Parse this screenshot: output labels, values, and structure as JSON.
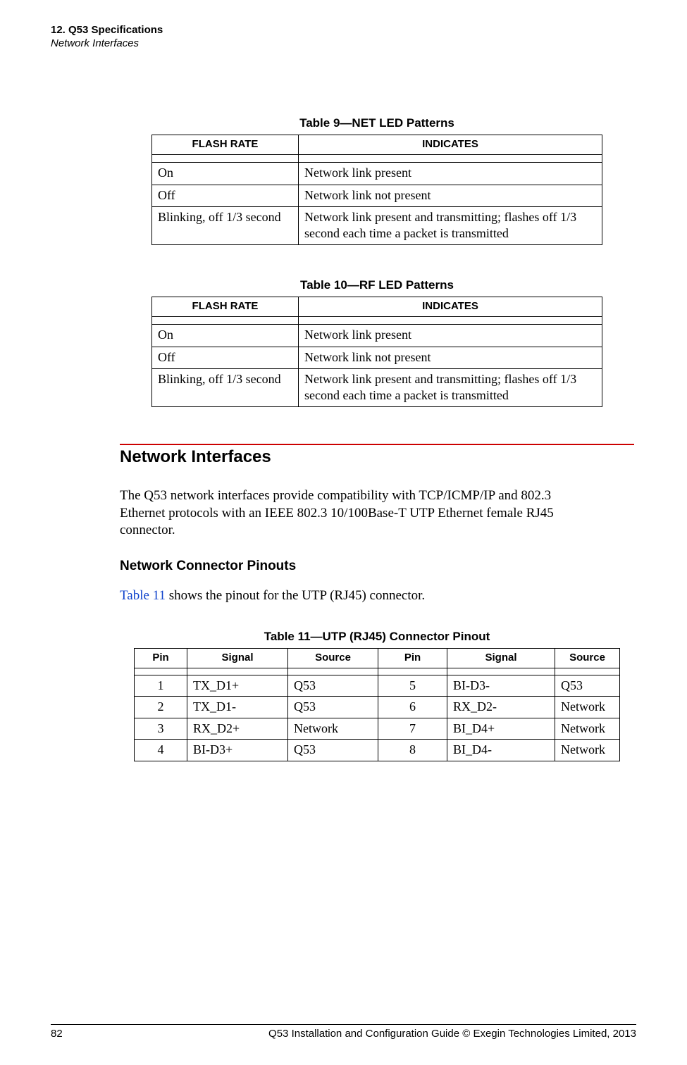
{
  "header": {
    "chapter": "12. Q53 Specifications",
    "section_running": "Network Interfaces"
  },
  "table9": {
    "caption": "Table 9—NET LED Patterns",
    "cols": [
      "FLASH RATE",
      "INDICATES"
    ],
    "rows": [
      {
        "rate": "On",
        "ind": "Network link present"
      },
      {
        "rate": "Off",
        "ind": "Network link not present"
      },
      {
        "rate": "Blinking, off 1/3 second",
        "ind": "Network link present and transmitting; flashes off 1/3 second each time a packet is transmitted"
      }
    ]
  },
  "table10": {
    "caption": "Table 10—RF LED Patterns",
    "cols": [
      "FLASH RATE",
      "INDICATES"
    ],
    "rows": [
      {
        "rate": "On",
        "ind": "Network link present"
      },
      {
        "rate": "Off",
        "ind": "Network link not present"
      },
      {
        "rate": "Blinking, off 1/3 second",
        "ind": "Network link present and transmitting; flashes off 1/3 second each time a packet is transmitted"
      }
    ]
  },
  "section": {
    "title": "Network Interfaces",
    "body": "The Q53 network interfaces provide compatibility with TCP/ICMP/IP and 802.3 Ethernet protocols with an IEEE 802.3 10/100Base-T UTP Ethernet female RJ45 connector."
  },
  "subsection": {
    "title": "Network Connector Pinouts",
    "lead_pre": "",
    "lead_link": "Table 11",
    "lead_post": " shows the pinout for the UTP (RJ45) connector."
  },
  "table11": {
    "caption": "Table 11—UTP (RJ45) Connector Pinout",
    "cols": [
      "Pin",
      "Signal",
      "Source",
      "Pin",
      "Signal",
      "Source"
    ],
    "rows": [
      {
        "p1": "1",
        "s1": "TX_D1+",
        "src1": "Q53",
        "p2": "5",
        "s2": "BI-D3-",
        "src2": "Q53"
      },
      {
        "p1": "2",
        "s1": "TX_D1-",
        "src1": "Q53",
        "p2": "6",
        "s2": "RX_D2-",
        "src2": "Network"
      },
      {
        "p1": "3",
        "s1": "RX_D2+",
        "src1": "Network",
        "p2": "7",
        "s2": "BI_D4+",
        "src2": "Network"
      },
      {
        "p1": "4",
        "s1": "BI-D3+",
        "src1": "Q53",
        "p2": "8",
        "s2": "BI_D4-",
        "src2": "Network"
      }
    ]
  },
  "footer": {
    "page": "82",
    "right": "Q53 Installation and Configuration Guide  © Exegin Technologies Limited, 2013"
  }
}
